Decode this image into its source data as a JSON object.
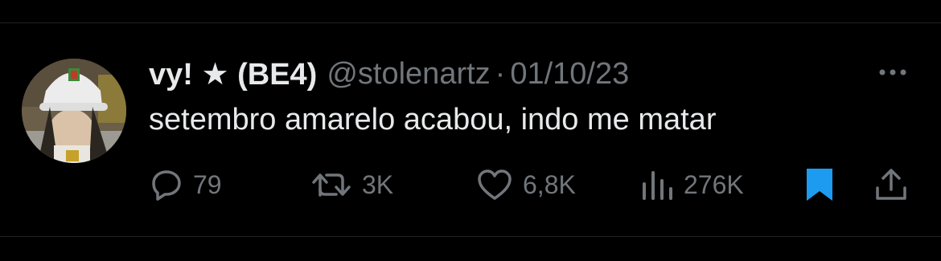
{
  "tweet": {
    "display_name": "vy! ★ (BE4)",
    "handle": "@stolenartz",
    "separator": "·",
    "date": "01/10/23",
    "text": "setembro amarelo acabou, indo me matar"
  },
  "actions": {
    "reply": {
      "icon": "reply-icon",
      "count": "79"
    },
    "retweet": {
      "icon": "retweet-icon",
      "count": "3K"
    },
    "like": {
      "icon": "heart-icon",
      "count": "6,8K"
    },
    "views": {
      "icon": "views-icon",
      "count": "276K"
    },
    "bookmark": {
      "icon": "bookmark-icon",
      "active": true
    },
    "share": {
      "icon": "share-icon"
    }
  },
  "colors": {
    "background": "#000000",
    "text": "#e7e9ea",
    "secondary": "#71767b",
    "accent": "#1d9bf0",
    "divider": "#1f2124"
  }
}
